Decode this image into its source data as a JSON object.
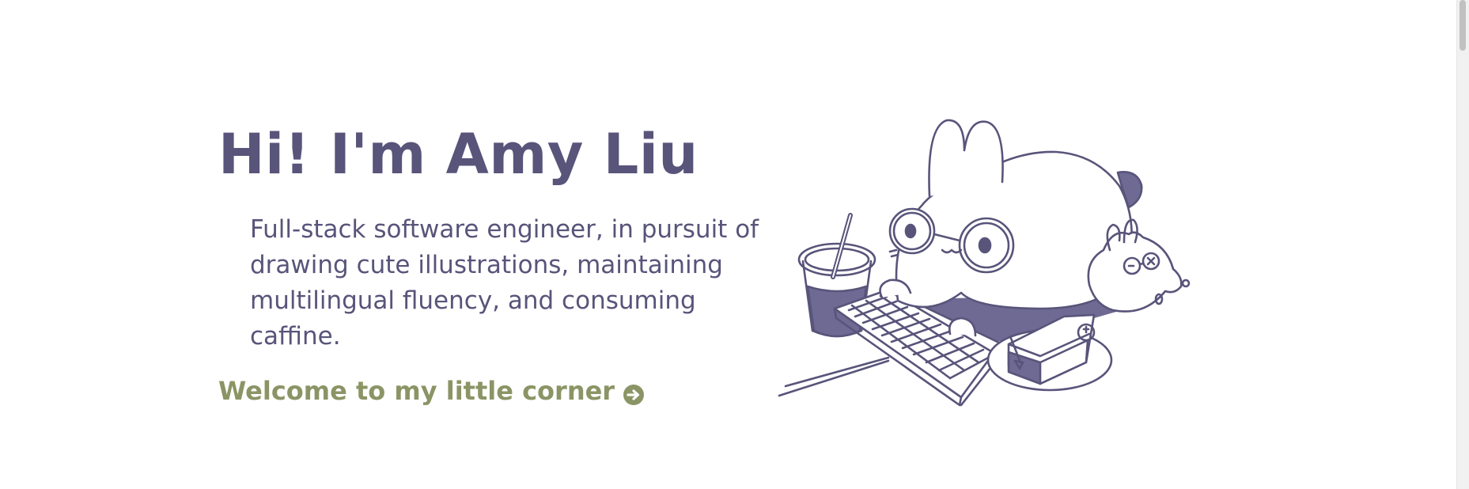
{
  "hero": {
    "title": "Hi! I'm Amy Liu",
    "description": "Full-stack software engineer, in pursuit of drawing cute illustrations, maintaining multilingual fluency, and consuming caffine.",
    "cta_label": "Welcome to my little corner",
    "cta_icon": "arrow-circle-right-icon"
  },
  "illustration": {
    "subject": "bunny-with-glasses-at-keyboard-illustration"
  },
  "colors": {
    "primary": "#58547a",
    "accent": "#8b9465",
    "background": "#ffffff"
  }
}
